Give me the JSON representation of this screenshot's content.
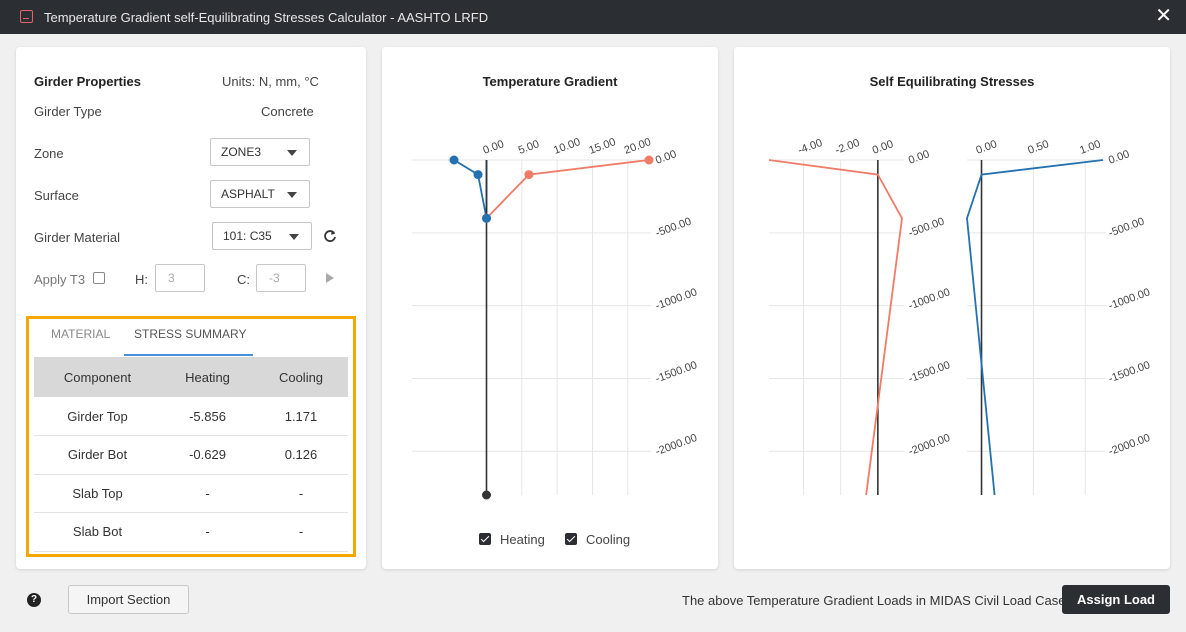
{
  "window": {
    "title": "Temperature Gradient self-Equilibrating Stresses Calculator - AASHTO LRFD"
  },
  "properties": {
    "heading": "Girder Properties",
    "units": "Units: N, mm, °C",
    "girder_type_label": "Girder Type",
    "girder_type_value": "Concrete",
    "zone_label": "Zone",
    "zone_value": "ZONE3",
    "surface_label": "Surface",
    "surface_value": "ASPHALT",
    "material_label": "Girder Material",
    "material_value": "101: C35",
    "apply_t3_label": "Apply T3",
    "h_label": "H:",
    "h_value": "3",
    "c_label": "C:",
    "c_value": "-3"
  },
  "tabs": {
    "material": "MATERIAL",
    "stress_summary": "STRESS SUMMARY"
  },
  "summary": {
    "headers": [
      "Component",
      "Heating",
      "Cooling"
    ],
    "rows": [
      [
        "Girder Top",
        "-5.856",
        "1.171"
      ],
      [
        "Girder Bot",
        "-0.629",
        "0.126"
      ],
      [
        "Slab Top",
        "-",
        "-"
      ],
      [
        "Slab Bot",
        "-",
        "-"
      ]
    ]
  },
  "gradient_chart": {
    "title": "Temperature Gradient",
    "x_ticks": [
      "0.00",
      "5.00",
      "10.00",
      "15.00",
      "20.00"
    ],
    "y_ticks": [
      "0.00",
      "-500.00",
      "-1000.00",
      "-1500.00",
      "-2000.00"
    ],
    "legend": {
      "heating": "Heating",
      "cooling": "Cooling"
    }
  },
  "stress_chart": {
    "title": "Self Equilibrating Stresses",
    "heating_x_ticks": [
      "-4.00",
      "-2.00",
      "0.00"
    ],
    "cooling_x_ticks": [
      "0.00",
      "0.50",
      "1.00"
    ],
    "y_ticks": [
      "0.00",
      "-500.00",
      "-1000.00",
      "-1500.00",
      "-2000.00"
    ]
  },
  "chart_data": [
    {
      "type": "line",
      "title": "Temperature Gradient",
      "ylim": [
        -2300,
        0
      ],
      "xlim": [
        -4.6,
        23
      ],
      "series": [
        {
          "name": "Heating",
          "color": "#f07c68",
          "points": [
            [
              23,
              0
            ],
            [
              6,
              -100
            ],
            [
              0,
              -400
            ],
            [
              0,
              0
            ]
          ]
        },
        {
          "name": "Cooling",
          "color": "#2371b0",
          "points": [
            [
              -4.6,
              0
            ],
            [
              -1.2,
              -100
            ],
            [
              0,
              -400
            ],
            [
              0,
              0
            ]
          ]
        },
        {
          "color": "#333333",
          "points": [
            [
              0,
              0
            ],
            [
              0,
              -2300
            ]
          ]
        }
      ]
    },
    {
      "type": "line",
      "title": "Self Equilibrating Stresses",
      "ylim": [
        -2300,
        0
      ],
      "series": [
        {
          "name": "Heating",
          "color": "#f07c68",
          "xlim": [
            -5.856,
            1.3
          ],
          "points": [
            [
              -5.856,
              0
            ],
            [
              0,
              -100
            ],
            [
              1.3,
              -400
            ],
            [
              -0.629,
              -2300
            ]
          ]
        },
        {
          "name": "Cooling",
          "color": "#2371b0",
          "xlim": [
            -0.14,
            1.171
          ],
          "points": [
            [
              1.171,
              0
            ],
            [
              0.0,
              -100
            ],
            [
              -0.14,
              -400
            ],
            [
              0.126,
              -2300
            ]
          ]
        }
      ]
    }
  ],
  "footer": {
    "import_button": "Import Section",
    "note": "The above Temperature Gradient Loads in MIDAS Civil Load Cases",
    "assign_button": "Assign Load"
  }
}
